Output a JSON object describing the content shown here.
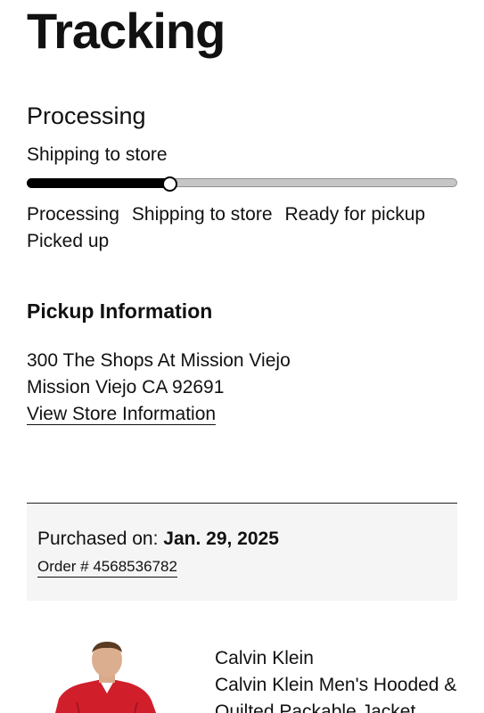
{
  "page_title": "Tracking",
  "status": {
    "heading": "Processing",
    "subheading": "Shipping to store",
    "progress_fraction": 0.33,
    "steps": [
      "Processing",
      "Shipping to store",
      "Ready for pickup",
      "Picked up"
    ]
  },
  "pickup": {
    "heading": "Pickup Information",
    "address_line1": "300 The Shops At Mission Viejo",
    "address_line2": "Mission Viejo CA 92691",
    "store_link": "View Store Information"
  },
  "order": {
    "purchased_label": "Purchased on:",
    "purchased_date": "Jan. 29, 2025",
    "order_number": "Order # 4568536782"
  },
  "product": {
    "brand": "Calvin Klein",
    "name": "Calvin Klein Men's Hooded & Quilted Packable Jacket",
    "image_icon": "product-photo",
    "jacket_color": "#d01f2b"
  },
  "colors": {
    "progress_fill": "#000000",
    "progress_track": "#c6c6c6",
    "order_box_bg": "#f5f5f5"
  }
}
